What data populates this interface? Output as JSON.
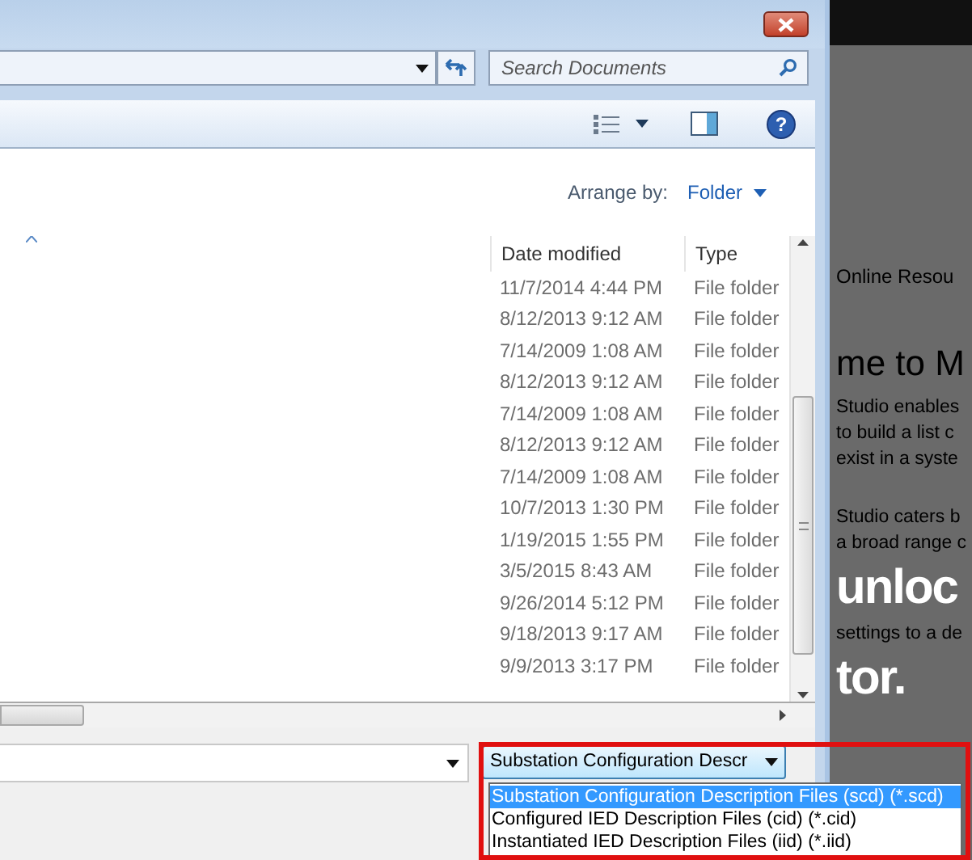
{
  "dialog": {
    "search": {
      "placeholder": "Search Documents"
    },
    "arrange_by": {
      "label": "Arrange by:",
      "value": "Folder"
    },
    "columns": [
      "Date modified",
      "Type"
    ],
    "rows": [
      {
        "date": "11/7/2014 4:44 PM",
        "type": "File folder"
      },
      {
        "date": "8/12/2013 9:12 AM",
        "type": "File folder"
      },
      {
        "date": "7/14/2009 1:08 AM",
        "type": "File folder"
      },
      {
        "date": "8/12/2013 9:12 AM",
        "type": "File folder"
      },
      {
        "date": "7/14/2009 1:08 AM",
        "type": "File folder"
      },
      {
        "date": "8/12/2013 9:12 AM",
        "type": "File folder"
      },
      {
        "date": "7/14/2009 1:08 AM",
        "type": "File folder"
      },
      {
        "date": "10/7/2013 1:30 PM",
        "type": "File folder"
      },
      {
        "date": "1/19/2015 1:55 PM",
        "type": "File folder"
      },
      {
        "date": "3/5/2015 8:43 AM",
        "type": "File folder"
      },
      {
        "date": "9/26/2014 5:12 PM",
        "type": "File folder"
      },
      {
        "date": "9/18/2013 9:17 AM",
        "type": "File folder"
      },
      {
        "date": "9/9/2013 3:17 PM",
        "type": "File folder"
      }
    ],
    "help": "?",
    "file_type": {
      "value": "Substation Configuration Descr",
      "expanded": true,
      "options": [
        {
          "label": "Substation Configuration Description Files (scd) (*.scd)",
          "selected": true
        },
        {
          "label": "Configured IED Description Files (cid) (*.cid)",
          "selected": false
        },
        {
          "label": "Instantiated IED Description Files (iid) (*.iid)",
          "selected": false
        }
      ]
    }
  },
  "background_app": {
    "texts": [
      {
        "kind": "link",
        "text": "Online Resou"
      },
      {
        "kind": "heading",
        "text": "me to M"
      },
      {
        "kind": "para",
        "text": "Studio enables"
      },
      {
        "kind": "para",
        "text": "to build a list c"
      },
      {
        "kind": "para",
        "text": "exist in a syste"
      },
      {
        "kind": "section",
        "text": "Studio caters b"
      },
      {
        "kind": "para",
        "text": "a broad range c"
      },
      {
        "kind": "big",
        "text": "unloc"
      },
      {
        "kind": "para",
        "text": "settings to a de"
      },
      {
        "kind": "big",
        "text": "tor."
      }
    ]
  }
}
